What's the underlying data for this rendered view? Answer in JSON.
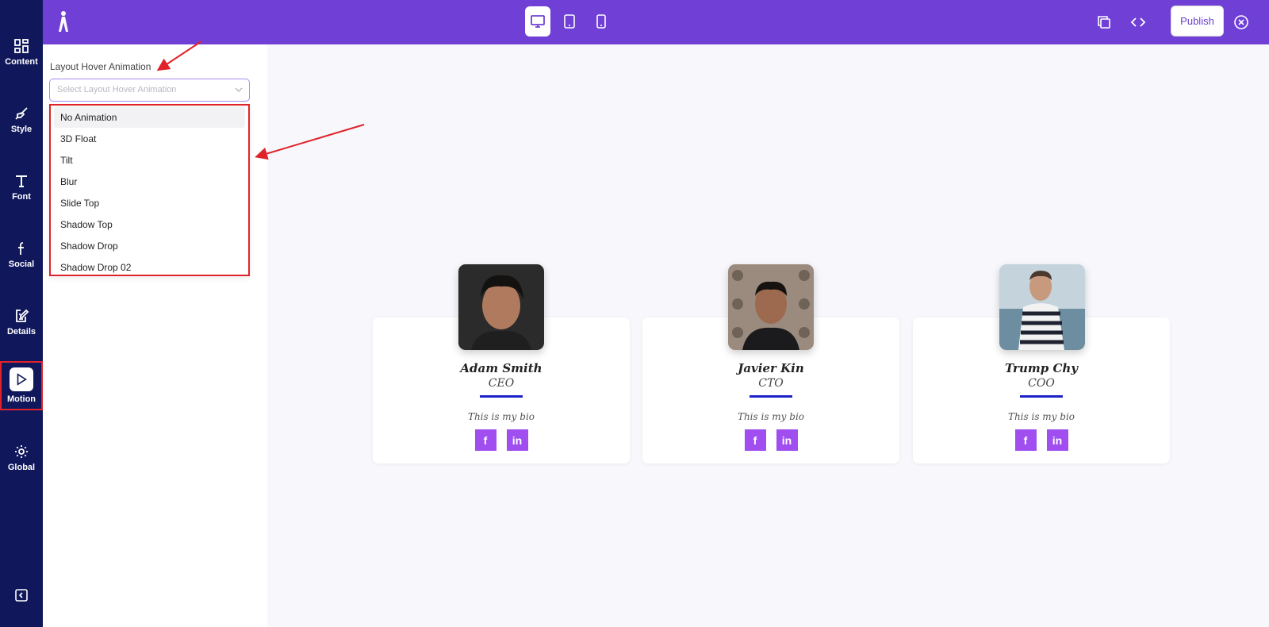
{
  "rail": {
    "items": [
      {
        "label": "Content",
        "icon": "grid-icon"
      },
      {
        "label": "Style",
        "icon": "brush-icon"
      },
      {
        "label": "Font",
        "icon": "text-icon"
      },
      {
        "label": "Social",
        "icon": "facebook-icon"
      },
      {
        "label": "Details",
        "icon": "edit-icon"
      },
      {
        "label": "Motion",
        "icon": "play-icon"
      },
      {
        "label": "Global",
        "icon": "gear-icon"
      }
    ],
    "active": "Motion"
  },
  "topbar": {
    "publish_label": "Publish",
    "active_device": "desktop",
    "accent_color": "#7040d6"
  },
  "panel": {
    "field_label": "Layout Hover Animation",
    "select_placeholder": "Select Layout Hover Animation",
    "options": [
      "No Animation",
      "3D Float",
      "Tilt",
      "Blur",
      "Slide Top",
      "Shadow Top",
      "Shadow Drop",
      "Shadow Drop 02"
    ],
    "highlighted_option": "No Animation"
  },
  "team": [
    {
      "name": "Adam Smith",
      "role": "CEO",
      "bio": "This is my bio"
    },
    {
      "name": "Javier Kin",
      "role": "CTO",
      "bio": "This is my bio"
    },
    {
      "name": "Trump Chy",
      "role": "COO",
      "bio": "This is my bio"
    }
  ],
  "colors": {
    "rail": "#10185b",
    "social_button": "#a04ef0",
    "rule": "#1a22c9",
    "annotation": "#e0232a"
  }
}
